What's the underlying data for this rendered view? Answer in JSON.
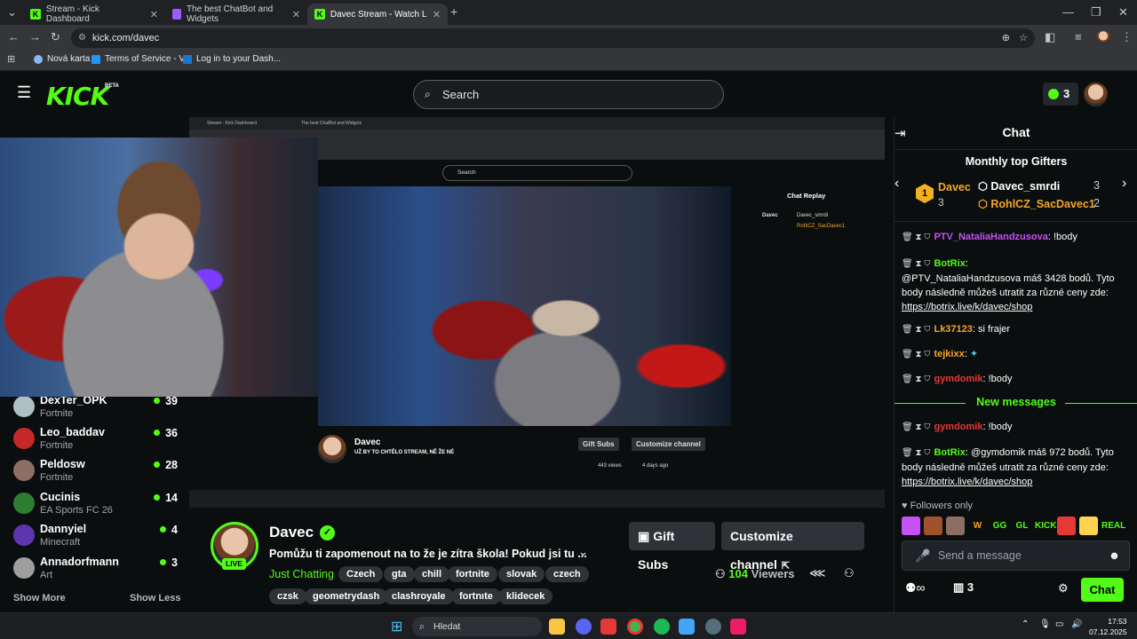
{
  "browser": {
    "tabs": [
      {
        "title": "Stream - Kick Dashboard",
        "active": false
      },
      {
        "title": "The best ChatBot and Widgets",
        "active": false
      },
      {
        "title": "Davec Stream - Watch Live on",
        "active": true
      }
    ],
    "new_tab": "+",
    "url": "kick.com/davec",
    "bookmarks": [
      "Nová karta",
      "Terms of Service - V...",
      "Log in to your Dash..."
    ]
  },
  "header": {
    "logo": "KICK",
    "beta": "BETA",
    "search_placeholder": "Search",
    "kicks_count": "3"
  },
  "sidebar": {
    "channels": [
      {
        "name": "DexTer_OPK",
        "category": "Fortnite",
        "viewers": "39",
        "color": "#b0bec5"
      },
      {
        "name": "Leo_baddav",
        "category": "Fortnite",
        "viewers": "36",
        "color": "#c62828"
      },
      {
        "name": "Peldosw",
        "category": "Fortnite",
        "viewers": "28",
        "color": "#8d6e63"
      },
      {
        "name": "Cucinis",
        "category": "EA Sports FC 26",
        "viewers": "14",
        "color": "#2e7d32"
      },
      {
        "name": "Dannyiel",
        "category": "Minecraft",
        "viewers": "4",
        "color": "#5e35b1"
      },
      {
        "name": "Annadorfmann",
        "category": "Art",
        "viewers": "3",
        "color": "#9e9e9e"
      }
    ],
    "show_more": "Show More",
    "show_less": "Show Less"
  },
  "inner": {
    "search": "Search",
    "chat_replay": "Chat Replay",
    "streamer": "Davec",
    "title": "UŽ BY TO CHTĚLO STREAM, NĚ ŽE NÉ",
    "views": "443 views",
    "ago": "4 days ago",
    "gift": "Gift Subs",
    "customize": "Customize channel"
  },
  "stream": {
    "name": "Davec",
    "live": "LIVE",
    "title": "Pomůžu ti zapomenout na to že je zítra škola! Pokud jsi tu ...",
    "category": "Just Chatting",
    "tags_row1": [
      "Czech",
      "gta",
      "chill",
      "fortnite",
      "slovak",
      "czech"
    ],
    "tags_row2": [
      "czsk",
      "geometrydash",
      "clashroyale",
      "fortnıte",
      "klidecek"
    ],
    "gift_subs": "Gift Subs",
    "customize": "Customize channel",
    "viewers_count": "104",
    "viewers_label": "Viewers"
  },
  "chat": {
    "title": "Chat",
    "top_gifters_title": "Monthly top Gifters",
    "gifter1": {
      "name": "Davec",
      "count": "3"
    },
    "gifter2": {
      "name": "Davec_smrdi",
      "count": "3"
    },
    "gifter3": {
      "name": "RohlCZ_SacDavec1",
      "count": "2"
    },
    "messages": [
      {
        "user": "PTV_NataliaHandzusova",
        "color": "#c651f5",
        "text": "!body"
      },
      {
        "user": "BotRix",
        "color": "#53fc18",
        "text": "@PTV_NataliaHandzusova máš 3428 bodů. Tyto body následně můžeš utratit za různé ceny zde: ",
        "link": "https://botrix.live/k/davec/shop"
      },
      {
        "user": "Lk37123",
        "color": "#f5a623",
        "text": "si frajer"
      },
      {
        "user": "tejkixx",
        "color": "#f5a623",
        "text": ""
      },
      {
        "user": "gymdomik",
        "color": "#e53935",
        "text": "!body"
      }
    ],
    "new_messages": "New messages",
    "messages_after": [
      {
        "user": "gymdomik",
        "color": "#e53935",
        "text": "!body"
      },
      {
        "user": "BotRix",
        "color": "#53fc18",
        "text": "@gymdomik máš 972 bodů. Tyto body následně můžeš utratit za různé ceny zde: ",
        "link": "https://botrix.live/k/davec/shop"
      }
    ],
    "followers_only": "Followers only",
    "emotes": [
      "",
      "",
      "",
      "W",
      "GG",
      "GL",
      "KICK",
      "",
      "",
      "REAL"
    ],
    "send_placeholder": "Send a message",
    "points": "3",
    "chat_button": "Chat"
  },
  "taskbar": {
    "search": "Hledat",
    "time": "17:53",
    "date": "07.12.2025"
  }
}
